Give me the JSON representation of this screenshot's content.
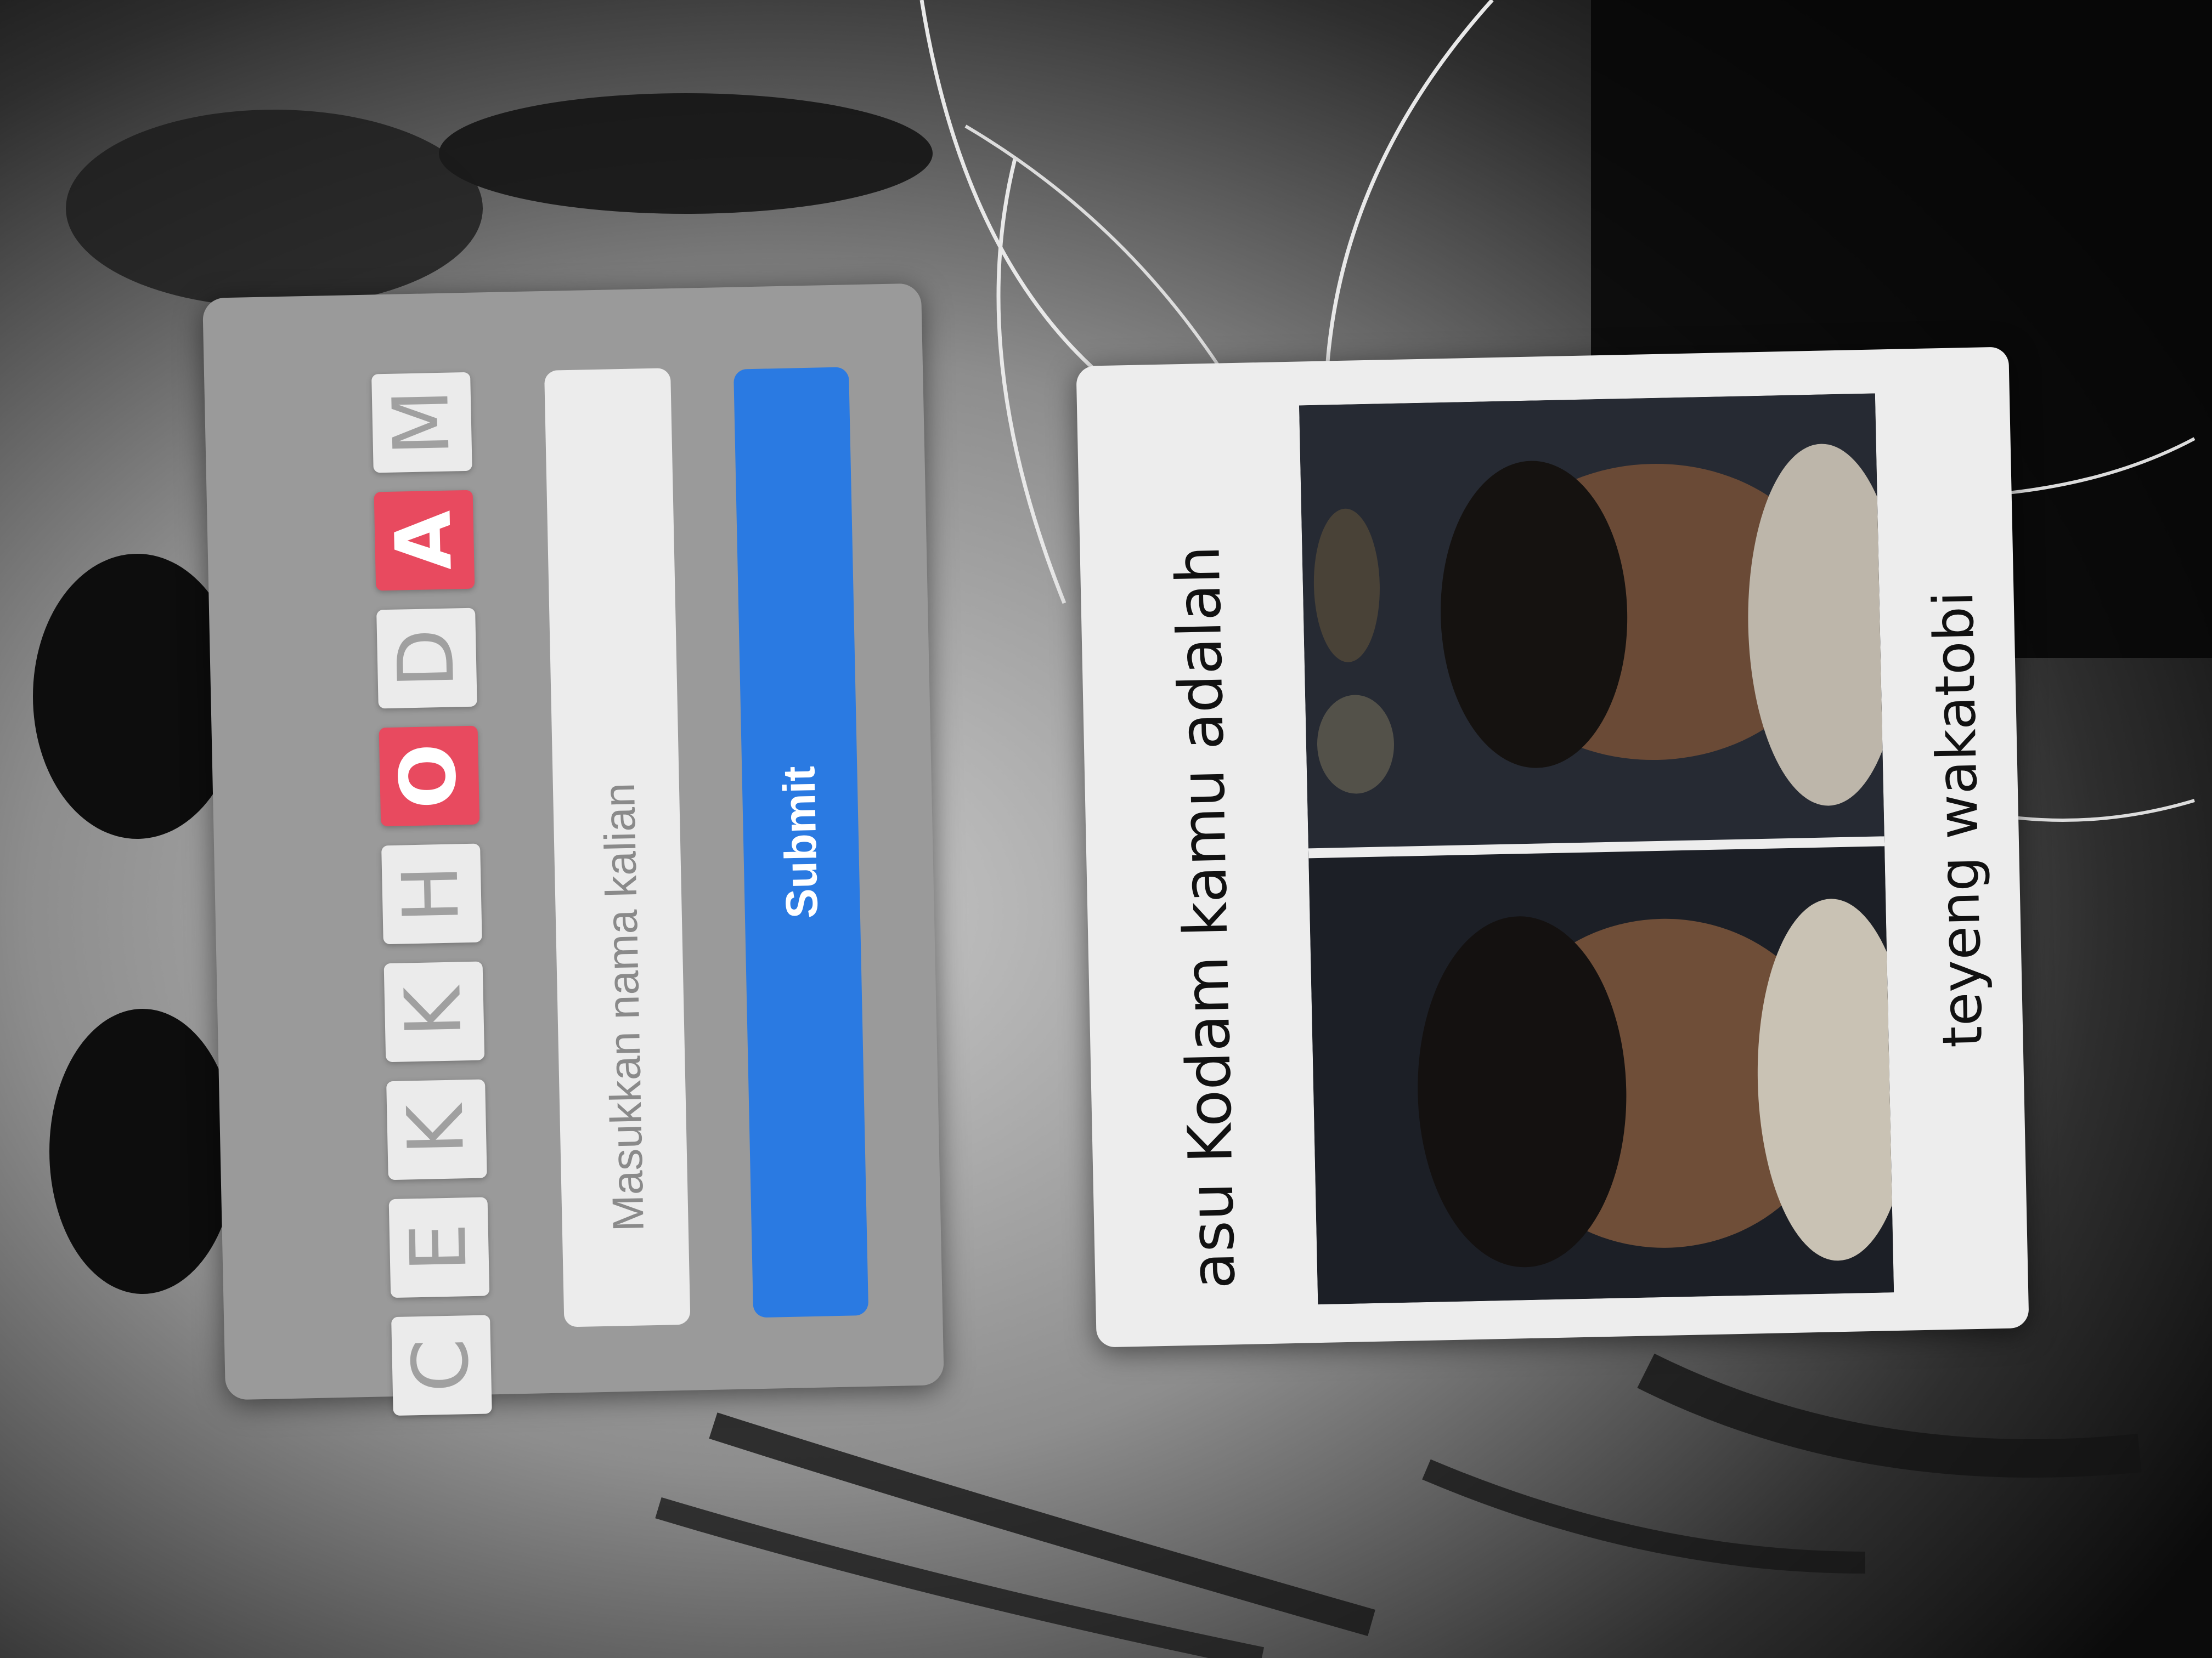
{
  "form": {
    "title_letters": [
      "C",
      "E",
      "K",
      "K",
      "H",
      "O",
      "D",
      "A",
      "M"
    ],
    "highlight_letters": [
      "O",
      "A"
    ],
    "name_placeholder": "Masukkan nama kalian",
    "submit_label": "Submit"
  },
  "result": {
    "heading": "asu Kodam kamu adalah",
    "name": "teyeng wakatobi"
  },
  "colors": {
    "tile_highlight": "#e84a5f",
    "submit_button": "#2a7ae2"
  }
}
